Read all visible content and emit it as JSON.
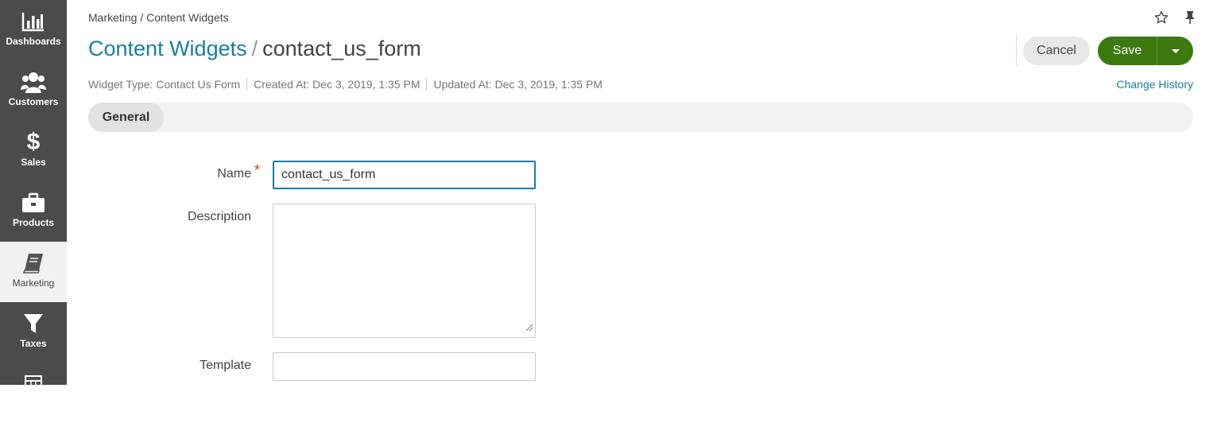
{
  "sidebar": {
    "items": [
      {
        "label": "Dashboards",
        "icon": "bar-chart-icon"
      },
      {
        "label": "Customers",
        "icon": "users-icon"
      },
      {
        "label": "Sales",
        "icon": "dollar-icon"
      },
      {
        "label": "Products",
        "icon": "briefcase-icon"
      },
      {
        "label": "Marketing",
        "icon": "book-icon",
        "active": true
      },
      {
        "label": "Taxes",
        "icon": "filter-icon"
      },
      {
        "label": "",
        "icon": "calculator-icon"
      }
    ]
  },
  "breadcrumb": "Marketing / Content Widgets",
  "header": {
    "entity": "Content Widgets",
    "separator": "/",
    "record": "contact_us_form"
  },
  "actions": {
    "cancel_label": "Cancel",
    "save_label": "Save"
  },
  "meta": {
    "widget_type": "Widget Type: Contact Us Form",
    "created_at": "Created At: Dec 3, 2019, 1:35 PM",
    "updated_at": "Updated At: Dec 3, 2019, 1:35 PM"
  },
  "change_history": "Change History",
  "tabs": [
    {
      "label": "General"
    }
  ],
  "form": {
    "name_label": "Name",
    "required_mark": "*",
    "name_value": "contact_us_form",
    "description_label": "Description",
    "template_label": "Template"
  },
  "colors": {
    "sidebar_bg": "#4b4b4b",
    "accent": "#1a7fa0",
    "save_green": "#3c7a0f",
    "required": "#c7451e"
  }
}
